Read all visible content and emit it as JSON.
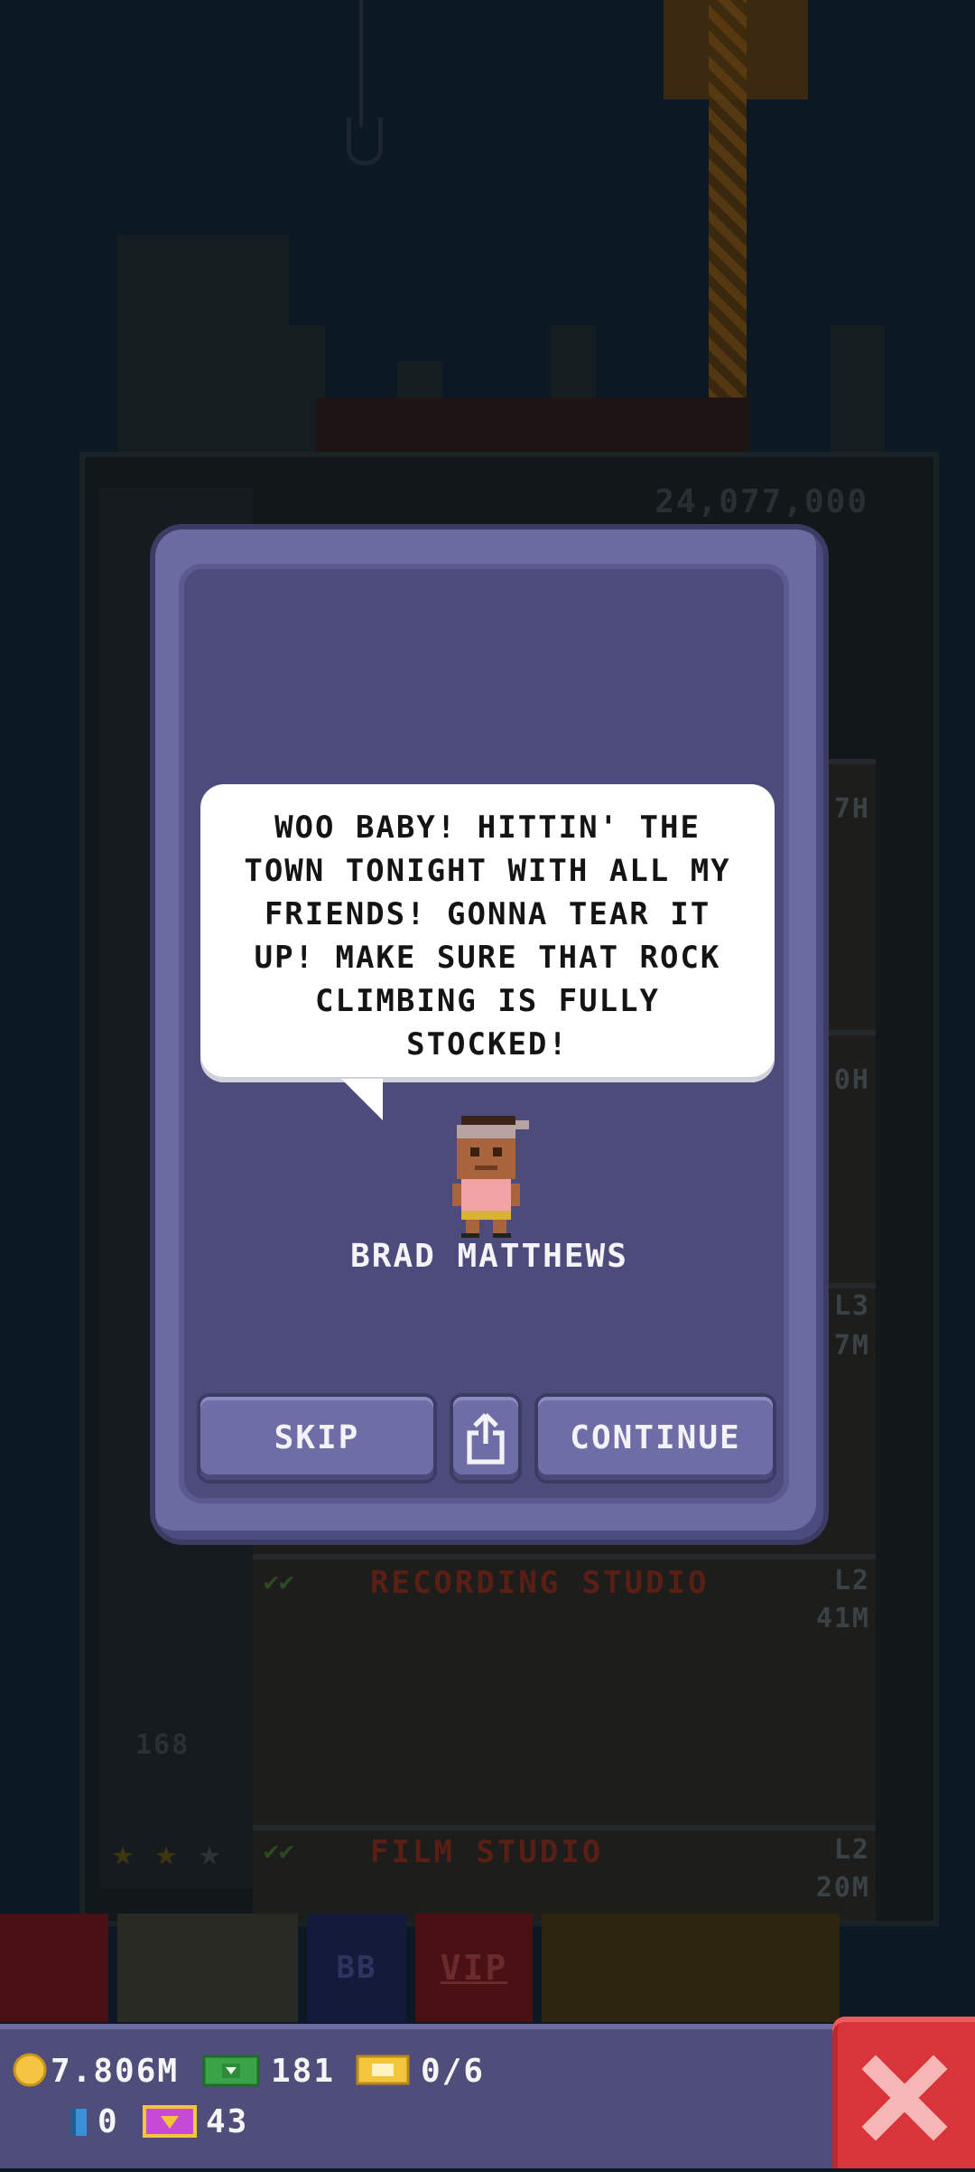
{
  "tower": {
    "top_value": "24,077,000",
    "floors": [
      {
        "name": "",
        "level": "7H",
        "cost": ""
      },
      {
        "name": "",
        "level": "0H",
        "cost": ""
      },
      {
        "name": "",
        "level": "L3",
        "cost": "7M"
      },
      {
        "name": "RECORDING STUDIO",
        "level": "L2",
        "cost": "41M"
      },
      {
        "name": "FILM STUDIO",
        "level": "L2",
        "cost": "20M"
      }
    ],
    "elevator_floor": "168"
  },
  "toolbar": {
    "bb_label": "BB",
    "vip_label": "VIP"
  },
  "dialog": {
    "message": "WOO BABY! HITTIN' THE TOWN TONIGHT WITH ALL MY FRIENDS! GONNA TEAR IT UP! MAKE SURE THAT ROCK CLIMBING IS FULLY STOCKED!",
    "character_name": "BRAD MATTHEWS",
    "skip_label": "SKIP",
    "continue_label": "CONTINUE",
    "share_icon": "share-icon"
  },
  "status": {
    "coins": "7.806M",
    "bux": "181",
    "tickets": "0/6",
    "keys": "0",
    "vip_count": "43"
  },
  "colors": {
    "modal": "#4d4b7c",
    "button": "#6e6da6",
    "close": "#d8353a",
    "coin": "#f5c542",
    "bux": "#3aa348"
  }
}
